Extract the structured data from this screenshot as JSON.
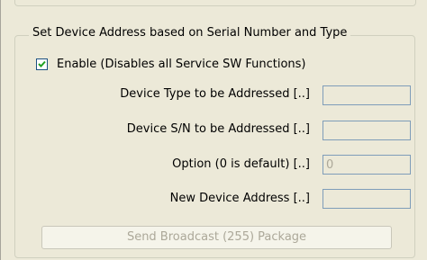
{
  "group": {
    "title": "Set Device Address based on Serial Number and Type"
  },
  "enable": {
    "label": "Enable (Disables all Service SW Functions)",
    "checked": true
  },
  "fields": [
    {
      "label": "Device Type to be Addressed [..]",
      "value": ""
    },
    {
      "label": "Device S/N to be Addressed [..]",
      "value": ""
    },
    {
      "label": "Option (0 is default) [..]",
      "value": "0"
    },
    {
      "label": "New Device Address [..]",
      "value": ""
    }
  ],
  "button": {
    "label": "Send Broadcast (255) Package"
  }
}
